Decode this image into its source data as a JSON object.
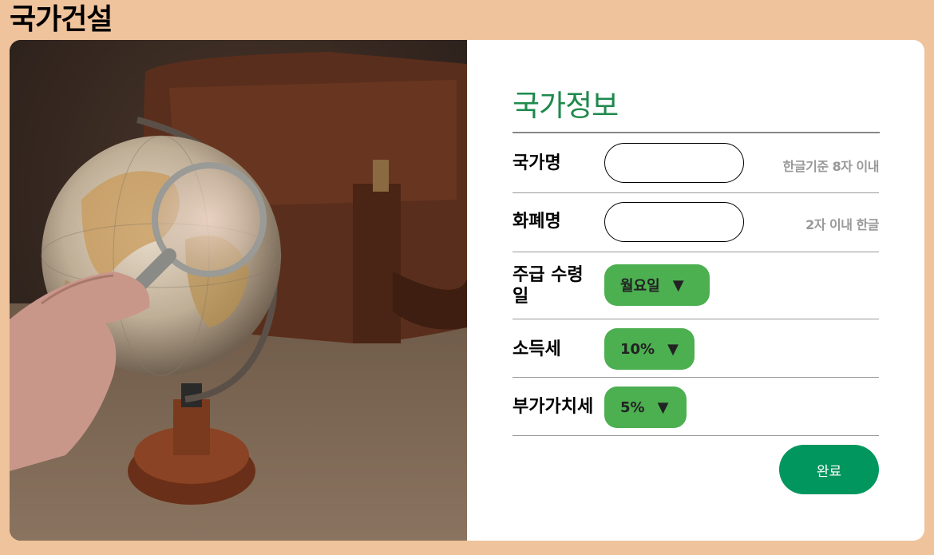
{
  "app": {
    "title": "국가건설"
  },
  "form": {
    "heading": "국가정보",
    "fields": [
      {
        "label": "국가명",
        "value": "",
        "hint": "한글기준 8자 이내"
      },
      {
        "label": "화폐명",
        "value": "",
        "hint": "2자 이내 한글"
      },
      {
        "label": "주급 수령일",
        "selected": "월요일",
        "caret": "▼"
      },
      {
        "label": "소득세",
        "selected": "10%",
        "caret": "▼"
      },
      {
        "label": "부가가치세",
        "selected": "5%",
        "caret": "▼"
      }
    ],
    "submit_label": "완료"
  },
  "colors": {
    "background": "#efc39c",
    "heading": "#1e8a4c",
    "select": "#4caf50",
    "submit": "#00965e"
  }
}
